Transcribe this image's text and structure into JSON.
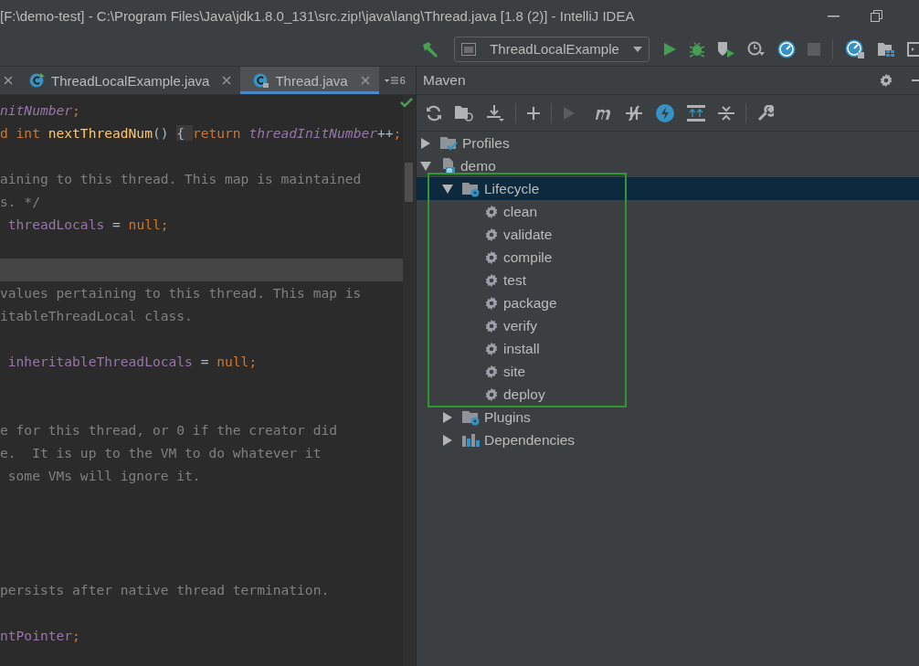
{
  "window": {
    "title": "[F:\\demo-test] - C:\\Program Files\\Java\\jdk1.8.0_131\\src.zip!\\java\\lang\\Thread.java [1.8 (2)] - IntelliJ IDEA"
  },
  "run_configuration": {
    "label": "ThreadLocalExample"
  },
  "editor": {
    "tabs": [
      {
        "label": "ThreadLocalExample.java",
        "selected": false
      },
      {
        "label": "Thread.java",
        "selected": true
      }
    ],
    "hidden_tab_count": "6",
    "lines": [
      {
        "current": false,
        "tokens": [
          {
            "text": "nitNumber",
            "kind": "field"
          },
          {
            "text": ";",
            "kind": "keyword"
          }
        ]
      },
      {
        "current": false,
        "tokens": [
          {
            "text": "d int ",
            "kind": "keyword"
          },
          {
            "text": "nextThreadNum",
            "kind": "method"
          },
          {
            "text": "() ",
            "kind": "plain"
          },
          {
            "text": "{ ",
            "kind": "folded"
          },
          {
            "text": "return ",
            "kind": "keyword"
          },
          {
            "text": "threadInitNumber",
            "kind": "field"
          },
          {
            "text": "++",
            "kind": "plain"
          },
          {
            "text": ";",
            "kind": "keyword"
          }
        ]
      },
      {
        "current": false
      },
      {
        "current": false,
        "tokens": [
          {
            "text": "aining to this thread. This map is maintained",
            "kind": "comment"
          }
        ]
      },
      {
        "current": false,
        "tokens": [
          {
            "text": "s. */",
            "kind": "comment"
          }
        ]
      },
      {
        "current": false,
        "tokens": [
          {
            "text": " threadLocals",
            "kind": "member"
          },
          {
            "text": " = ",
            "kind": "plain"
          },
          {
            "text": "null;",
            "kind": "keyword"
          }
        ]
      },
      {
        "current": false
      },
      {
        "current": true
      },
      {
        "current": false,
        "tokens": [
          {
            "text": "values pertaining to this thread. This map is",
            "kind": "comment"
          }
        ]
      },
      {
        "current": false,
        "tokens": [
          {
            "text": "itableThreadLocal class.",
            "kind": "comment"
          }
        ]
      },
      {
        "current": false
      },
      {
        "current": false,
        "tokens": [
          {
            "text": " inheritableThreadLocals",
            "kind": "member"
          },
          {
            "text": " = ",
            "kind": "plain"
          },
          {
            "text": "null;",
            "kind": "keyword"
          }
        ]
      },
      {
        "current": false
      },
      {
        "current": false
      },
      {
        "current": false,
        "tokens": [
          {
            "text": "e for this thread, or 0 if the creator did",
            "kind": "comment"
          }
        ]
      },
      {
        "current": false,
        "tokens": [
          {
            "text": "e.  It is up to the VM to do whatever it",
            "kind": "comment"
          }
        ]
      },
      {
        "current": false,
        "tokens": [
          {
            "text": " some VMs will ignore it.",
            "kind": "comment"
          }
        ]
      },
      {
        "current": false
      },
      {
        "current": false
      },
      {
        "current": false
      },
      {
        "current": false
      },
      {
        "current": false,
        "tokens": [
          {
            "text": "persists after native thread termination.",
            "kind": "comment"
          }
        ]
      },
      {
        "current": false
      },
      {
        "current": false,
        "tokens": [
          {
            "text": "ntPointer",
            "kind": "member"
          },
          {
            "text": ";",
            "kind": "keyword"
          }
        ]
      }
    ]
  },
  "maven": {
    "title": "Maven",
    "tree": [
      {
        "label": "Profiles",
        "kind": "profiles",
        "expanded": false,
        "selected": false
      },
      {
        "label": "demo",
        "kind": "project",
        "expanded": true,
        "selected": false,
        "children": [
          {
            "label": "Lifecycle",
            "kind": "lifecycle",
            "expanded": true,
            "selected": true,
            "children": [
              {
                "label": "clean",
                "kind": "goal",
                "selected": false
              },
              {
                "label": "validate",
                "kind": "goal",
                "selected": false
              },
              {
                "label": "compile",
                "kind": "goal",
                "selected": false
              },
              {
                "label": "test",
                "kind": "goal",
                "selected": false
              },
              {
                "label": "package",
                "kind": "goal",
                "selected": false
              },
              {
                "label": "verify",
                "kind": "goal",
                "selected": false
              },
              {
                "label": "install",
                "kind": "goal",
                "selected": false
              },
              {
                "label": "site",
                "kind": "goal",
                "selected": false
              },
              {
                "label": "deploy",
                "kind": "goal",
                "selected": false
              }
            ]
          },
          {
            "label": "Plugins",
            "kind": "plugins",
            "expanded": false,
            "selected": false
          },
          {
            "label": "Dependencies",
            "kind": "dependencies",
            "expanded": false,
            "selected": false
          }
        ]
      }
    ]
  }
}
